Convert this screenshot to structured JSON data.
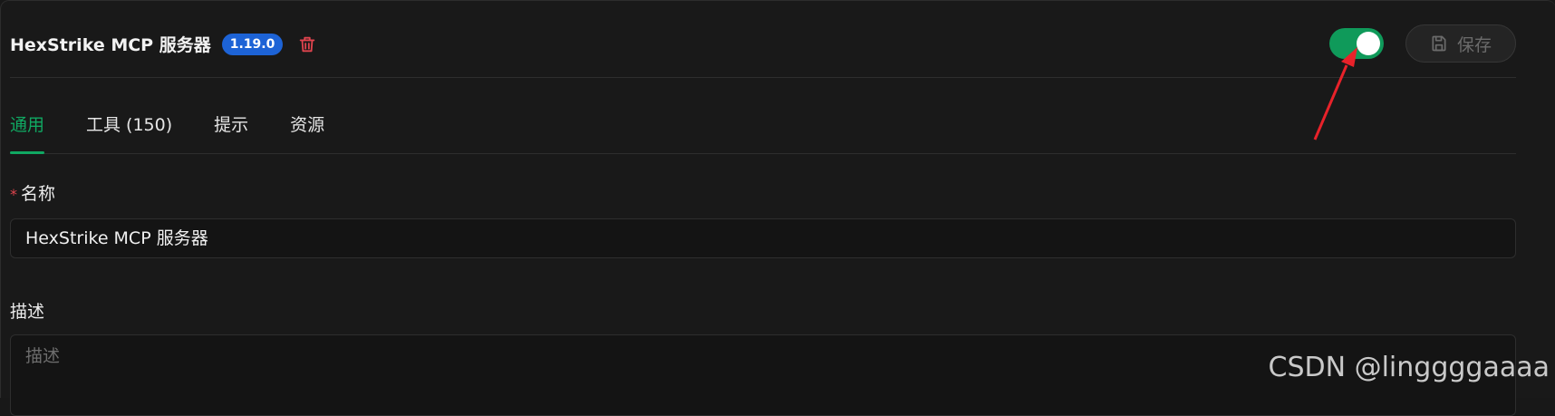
{
  "header": {
    "title": "HexStrike MCP 服务器",
    "version": "1.19.0",
    "save_label": "保存",
    "toggle_on": true
  },
  "tabs": [
    {
      "label": "通用",
      "active": true
    },
    {
      "label": "工具 (150)",
      "active": false
    },
    {
      "label": "提示",
      "active": false
    },
    {
      "label": "资源",
      "active": false
    }
  ],
  "form": {
    "name_required_mark": "*",
    "name_label": "名称",
    "name_value": "HexStrike MCP 服务器",
    "desc_label": "描述",
    "desc_placeholder": "描述"
  },
  "watermark": "CSDN @linggggaaaa",
  "colors": {
    "accent_green": "#10a862",
    "badge_blue": "#1d63d6",
    "danger_red": "#e0444e",
    "annotation_arrow": "#e8222a"
  }
}
